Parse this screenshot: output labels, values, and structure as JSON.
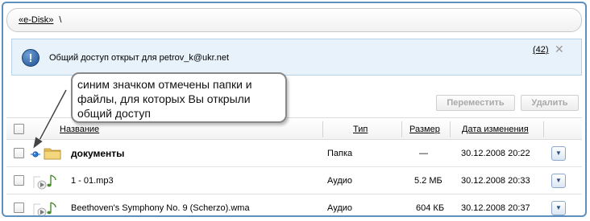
{
  "breadcrumb": {
    "root_label": "«e-Disk»",
    "separator": "\\"
  },
  "notice": {
    "text": "Общий доступ открыт для petrov_k@ukr.net",
    "count": "(42)",
    "close": "✕",
    "icon": "exclamation-icon"
  },
  "toolbar": {
    "move_label": "Переместить",
    "delete_label": "Удалить"
  },
  "table": {
    "columns": {
      "name": "Название",
      "type": "Тип",
      "size": "Размер",
      "modified": "Дата изменения"
    },
    "rows": [
      {
        "name": "документы",
        "type": "Папка",
        "size": "—",
        "modified": "30.12.2008 20:22",
        "icon": "shared-folder-icon"
      },
      {
        "name": "1 - 01.mp3",
        "type": "Аудио",
        "size": "5.2 МБ",
        "modified": "30.12.2008 20:33",
        "icon": "audio-file-icon"
      },
      {
        "name": "Beethoven's Symphony No. 9 (Scherzo).wma",
        "type": "Аудио",
        "size": "604 КБ",
        "modified": "30.12.2008 20:37",
        "icon": "audio-file-icon"
      }
    ]
  },
  "callout": {
    "text": "синим значком отмечены папки и файлы, для которых Вы открыли общий доступ"
  },
  "colors": {
    "frame": "#5d8fc0",
    "notice_bg": "#e8f2fb",
    "shared_marker": "#2a7bd5"
  }
}
